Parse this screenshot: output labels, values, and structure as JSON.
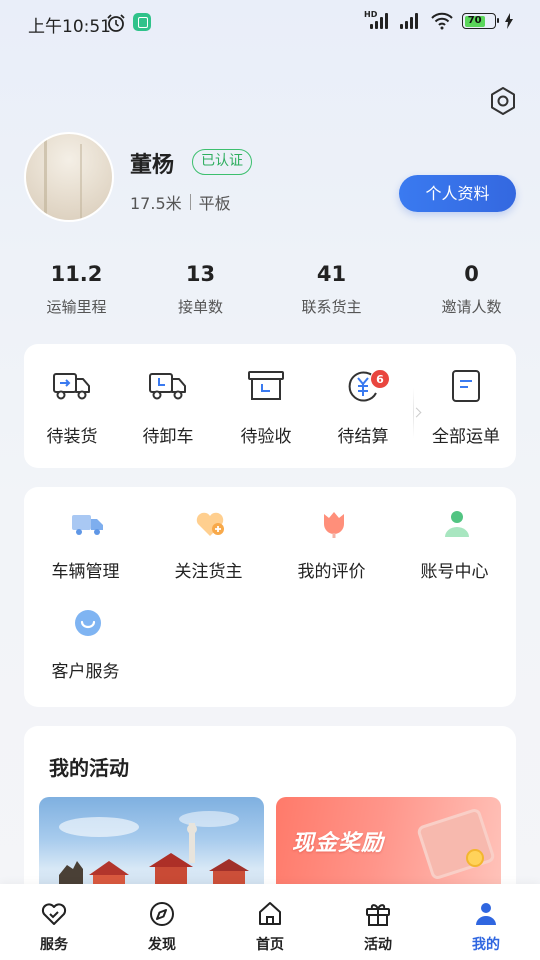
{
  "status_bar": {
    "time": "上午10:51",
    "network_label": "HD",
    "battery": "70"
  },
  "profile": {
    "name": "董杨",
    "verified_label": "已认证",
    "vehicle_length": "17.5米",
    "vehicle_type": "平板",
    "profile_button_label": "个人资料"
  },
  "stats": [
    {
      "value": "11.2",
      "label": "运输里程"
    },
    {
      "value": "13",
      "label": "接单数"
    },
    {
      "value": "41",
      "label": "联系货主"
    },
    {
      "value": "0",
      "label": "邀请人数"
    }
  ],
  "orders": [
    {
      "label": "待装货",
      "icon": "truck-loading-icon"
    },
    {
      "label": "待卸车",
      "icon": "truck-unloading-icon"
    },
    {
      "label": "待验收",
      "icon": "inspection-box-icon"
    },
    {
      "label": "待结算",
      "icon": "yuan-settlement-icon",
      "badge": "6"
    },
    {
      "label": "全部运单",
      "icon": "waybill-list-icon"
    }
  ],
  "services": [
    {
      "label": "车辆管理",
      "icon": "vehicle-icon"
    },
    {
      "label": "关注货主",
      "icon": "heart-plus-icon"
    },
    {
      "label": "我的评价",
      "icon": "tulip-icon"
    },
    {
      "label": "账号中心",
      "icon": "user-icon"
    },
    {
      "label": "客户服务",
      "icon": "chat-bubble-icon"
    }
  ],
  "activity": {
    "title": "我的活动",
    "banner_right_text": "现金奖励"
  },
  "bottom_nav": [
    {
      "label": "服务",
      "icon": "heart-outline-icon",
      "active": false
    },
    {
      "label": "发现",
      "icon": "compass-icon",
      "active": false
    },
    {
      "label": "首页",
      "icon": "home-icon",
      "active": false
    },
    {
      "label": "活动",
      "icon": "gift-icon",
      "active": false
    },
    {
      "label": "我的",
      "icon": "person-icon",
      "active": true
    }
  ],
  "colors": {
    "accent": "#3a7af0",
    "verified": "#3dbf6e",
    "badge": "#e9463f"
  }
}
